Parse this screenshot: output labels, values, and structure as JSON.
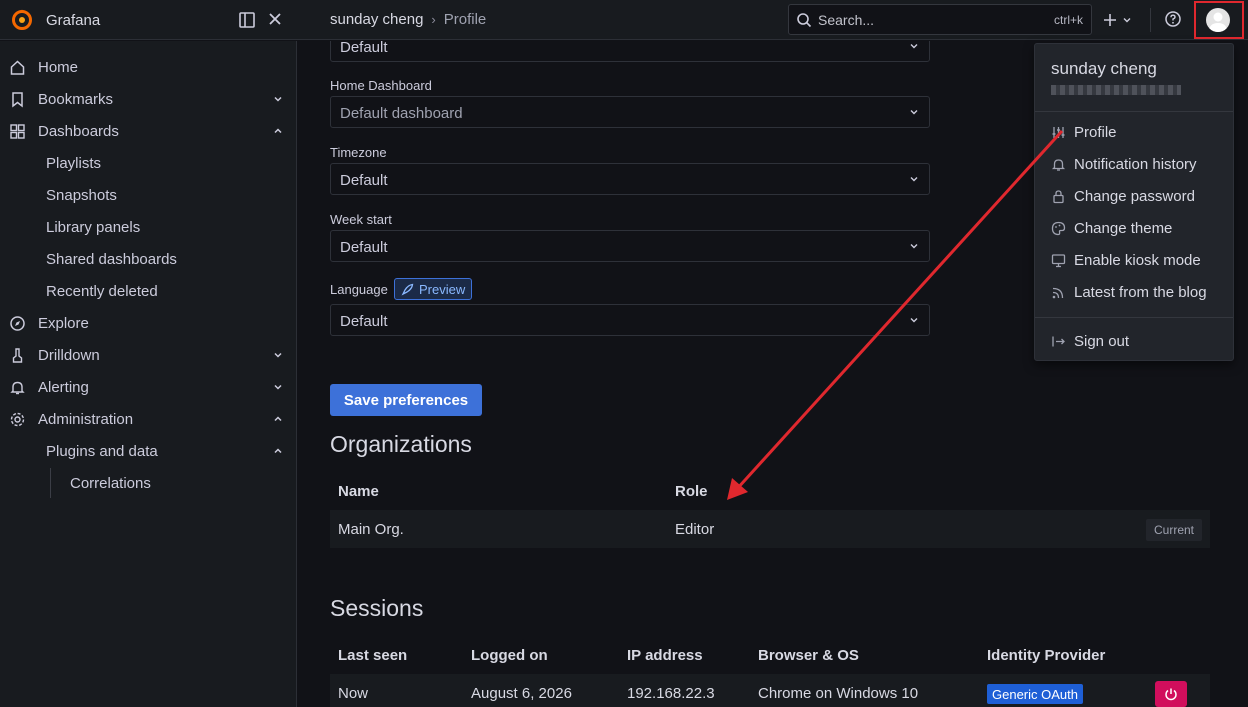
{
  "app": {
    "name": "Grafana",
    "brand_color": "#f46800"
  },
  "breadcrumb": {
    "user": "sunday cheng",
    "separator": "›",
    "page": "Profile"
  },
  "search": {
    "placeholder": "Search...",
    "shortcut": "ctrl+k"
  },
  "sidebar": {
    "items": [
      {
        "label": "Home",
        "icon": "home-icon"
      },
      {
        "label": "Bookmarks",
        "icon": "bookmark-icon",
        "chevron": "down"
      },
      {
        "label": "Dashboards",
        "icon": "apps-icon",
        "chevron": "up"
      },
      {
        "label": "Playlists"
      },
      {
        "label": "Snapshots"
      },
      {
        "label": "Library panels"
      },
      {
        "label": "Shared dashboards"
      },
      {
        "label": "Recently deleted"
      },
      {
        "label": "Explore",
        "icon": "compass-icon"
      },
      {
        "label": "Drilldown",
        "icon": "drilldown-icon",
        "chevron": "down"
      },
      {
        "label": "Alerting",
        "icon": "bell-icon",
        "chevron": "down"
      },
      {
        "label": "Administration",
        "icon": "cog-icon",
        "chevron": "up"
      },
      {
        "label": "Plugins and data",
        "chevron": "up"
      },
      {
        "label": "Correlations"
      }
    ]
  },
  "preferences": {
    "top_select_value": "Default",
    "home_dashboard": {
      "label": "Home Dashboard",
      "placeholder": "Default dashboard"
    },
    "timezone": {
      "label": "Timezone",
      "value": "Default"
    },
    "week_start": {
      "label": "Week start",
      "value": "Default"
    },
    "language": {
      "label": "Language",
      "value": "Default",
      "badge": "Preview"
    },
    "save_label": "Save preferences"
  },
  "organizations": {
    "title": "Organizations",
    "columns": [
      "Name",
      "Role"
    ],
    "rows": [
      {
        "name": "Main Org.",
        "role": "Editor",
        "tag": "Current"
      }
    ]
  },
  "sessions": {
    "title": "Sessions",
    "columns": [
      "Last seen",
      "Logged on",
      "IP address",
      "Browser & OS",
      "Identity Provider"
    ],
    "rows": [
      {
        "last_seen": "Now",
        "logged_on": "August 6, 2026",
        "ip": "192.168.22.3",
        "browser": "Chrome on Windows 10",
        "provider": "Generic OAuth"
      }
    ]
  },
  "user_menu": {
    "name": "sunday cheng",
    "items": [
      {
        "label": "Profile",
        "icon": "sliders-icon"
      },
      {
        "label": "Notification history",
        "icon": "bell-icon"
      },
      {
        "label": "Change password",
        "icon": "lock-icon"
      },
      {
        "label": "Change theme",
        "icon": "palette-icon"
      },
      {
        "label": "Enable kiosk mode",
        "icon": "monitor-icon"
      },
      {
        "label": "Latest from the blog",
        "icon": "rss-icon"
      }
    ],
    "sign_out": "Sign out"
  },
  "colors": {
    "primary": "#3d71d9",
    "danger": "#d10e5c",
    "annotation": "#e0282e"
  }
}
